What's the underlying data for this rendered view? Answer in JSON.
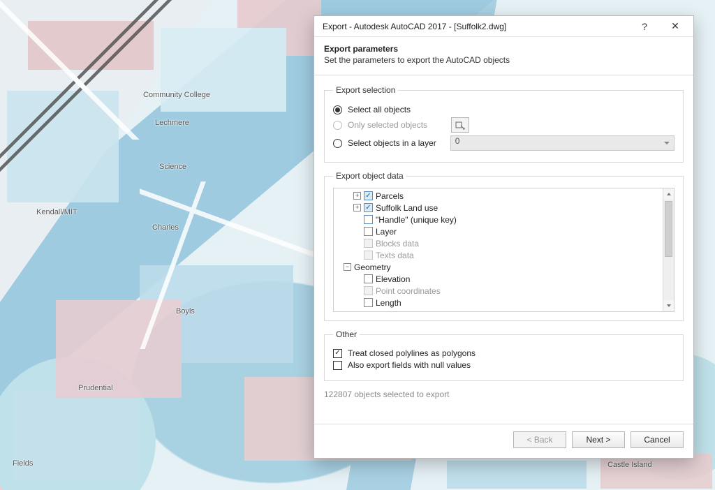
{
  "map_labels": {
    "a": "Community College",
    "b": "Lechmere",
    "c": "Science",
    "d": "Kendall/MIT",
    "e": "Charles",
    "f": "Boyls",
    "g": "Prudential",
    "h": "Fields",
    "i": "Castle Island"
  },
  "dialog": {
    "title": "Export - Autodesk AutoCAD 2017 - [Suffolk2.dwg]",
    "header_title": "Export parameters",
    "header_sub": "Set the parameters to export the AutoCAD objects",
    "selection": {
      "legend": "Export selection",
      "opt_all": "Select all objects",
      "opt_selected": "Only selected objects",
      "opt_layer": "Select objects in a layer",
      "layer_value": "0"
    },
    "objectdata": {
      "legend": "Export object data",
      "items": {
        "parcels": "Parcels",
        "landuse": "Suffolk Land use",
        "handle": "\"Handle\" (unique key)",
        "layer": "Layer",
        "blocks": "Blocks data",
        "texts": "Texts data",
        "geometry": "Geometry",
        "elevation": "Elevation",
        "pointcoords": "Point coordinates",
        "length": "Length"
      }
    },
    "other": {
      "legend": "Other",
      "polylines": "Treat closed polylines as polygons",
      "nulls": "Also export fields with null values"
    },
    "status": "122807 objects selected to export",
    "buttons": {
      "back": "< Back",
      "next": "Next >",
      "cancel": "Cancel"
    }
  }
}
